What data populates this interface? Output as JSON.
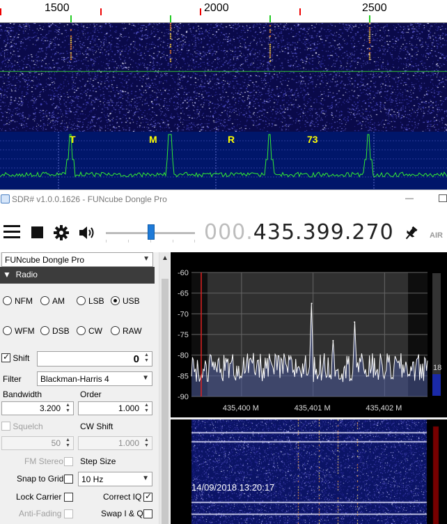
{
  "top_decoder": {
    "ruler_labels": [
      "1500",
      "2000",
      "2500"
    ],
    "decoded_chars": [
      "T",
      "M",
      "R",
      "73"
    ]
  },
  "window": {
    "title": "SDR# v1.0.0.1626 - FUNcube Dongle Pro",
    "minimize": "—"
  },
  "toolbar": {
    "frequency_dim": "000.",
    "frequency_lit": "435.399.270",
    "logo_text": "AIR"
  },
  "left_panel": {
    "source": "FUNcube Dongle Pro",
    "radio_header": "Radio",
    "modes_row1": [
      {
        "label": "NFM",
        "selected": false
      },
      {
        "label": "AM",
        "selected": false
      },
      {
        "label": "LSB",
        "selected": false
      },
      {
        "label": "USB",
        "selected": true
      }
    ],
    "modes_row2": [
      {
        "label": "WFM",
        "selected": false
      },
      {
        "label": "DSB",
        "selected": false
      },
      {
        "label": "CW",
        "selected": false
      },
      {
        "label": "RAW",
        "selected": false
      }
    ],
    "shift_label": "Shift",
    "shift_value": "0",
    "filter_label": "Filter",
    "filter_value": "Blackman-Harris 4",
    "bandwidth_label": "Bandwidth",
    "bandwidth_value": "3.200",
    "order_label": "Order",
    "order_value": "1.000",
    "squelch_label": "Squelch",
    "squelch_value": "50",
    "cw_shift_label": "CW Shift",
    "cw_shift_value": "1.000",
    "fm_stereo_label": "FM Stereo",
    "step_size_label": "Step Size",
    "step_size_value": "10 Hz",
    "snap_label": "Snap to Grid",
    "lock_carrier_label": "Lock Carrier",
    "correct_iq_label": "Correct IQ",
    "anti_fading_label": "Anti-Fading",
    "swap_iq_label": "Swap I & Q"
  },
  "spectrum": {
    "level_readout": "18",
    "timestamp": "14/09/2018 13:20:17"
  },
  "chart_data": {
    "type": "line",
    "title": "",
    "xlabel": "",
    "ylabel": "",
    "y_ticks": [
      "-60",
      "-65",
      "-70",
      "-75",
      "-80",
      "-85",
      "-90"
    ],
    "ylim": [
      -90,
      -60
    ],
    "x_ticks": [
      "435,400 M",
      "435,401 M",
      "435,402 M"
    ],
    "x_tick_values": [
      435.4,
      435.401,
      435.402
    ],
    "xlim": [
      435.3993,
      435.4026
    ],
    "noise_floor_db": -83,
    "peaks": [
      {
        "x": 435.40098,
        "y": -67.5
      },
      {
        "x": 435.40128,
        "y": -76.5
      },
      {
        "x": 435.40158,
        "y": -72
      }
    ],
    "grid": true
  },
  "colors": {
    "accent": "#1e7ad8",
    "waterfall_bg": "#0a0a4a",
    "trace_green": "#33ee33",
    "decoded_yellow": "#ffff00"
  }
}
